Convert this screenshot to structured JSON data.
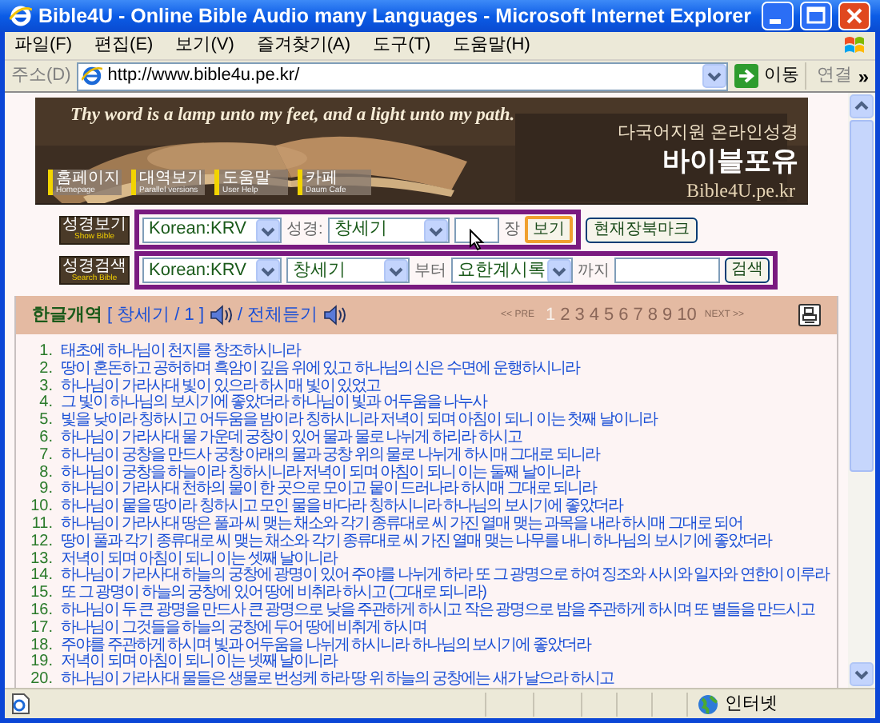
{
  "window": {
    "title": "Bible4U - Online Bible Audio many Languages - Microsoft Internet Explorer"
  },
  "menu": [
    "파일(F)",
    "편집(E)",
    "보기(V)",
    "즐겨찾기(A)",
    "도구(T)",
    "도움말(H)"
  ],
  "address_bar": {
    "label": "주소(D)",
    "value": "http://www.bible4u.pe.kr/",
    "go": "이동",
    "links": "연결",
    "more": "»"
  },
  "banner": {
    "motto": "Thy word is a lamp unto my feet, and a light unto my path.",
    "tagline": "다국어지원 온라인성경",
    "site_name": "바이블포유",
    "domain": "Bible4U.pe.kr",
    "nav": [
      {
        "label": "홈페이지",
        "sub": "Homepage"
      },
      {
        "label": "대역보기",
        "sub": "Parallel versions"
      },
      {
        "label": "도움말",
        "sub": "User Help"
      },
      {
        "label": "카페",
        "sub": "Daum Cafe"
      }
    ]
  },
  "show_bible": {
    "badge": "성경보기",
    "badge_sub": "Show Bible",
    "version": "Korean:KRV",
    "book_label": "성경:",
    "book": "창세기",
    "chapter_unit": "장",
    "view_button": "보기",
    "bookmark_button": "현재장북마크"
  },
  "search_bible": {
    "badge": "성경검색",
    "badge_sub": "Search Bible",
    "version": "Korean:KRV",
    "from_book": "창세기",
    "from_label": "부터",
    "to_book": "요한계시록",
    "to_label": "까지",
    "search_button": "검색"
  },
  "chapter_bar": {
    "version": "한글개역",
    "reference": "[ 창세기 / 1 ]",
    "listen_all": "/ 전체듣기",
    "pager": {
      "prev": "<< PRE",
      "next": "NEXT >>",
      "pages": [
        {
          "label": "1",
          "selected": true
        },
        {
          "label": "2",
          "selected": false
        },
        {
          "label": "3",
          "selected": false
        },
        {
          "label": "4",
          "selected": false
        },
        {
          "label": "5",
          "selected": false
        },
        {
          "label": "6",
          "selected": false
        },
        {
          "label": "7",
          "selected": false
        },
        {
          "label": "8",
          "selected": false
        },
        {
          "label": "9",
          "selected": false
        },
        {
          "label": "10",
          "selected": false
        }
      ]
    }
  },
  "verses": [
    {
      "number": "1.",
      "text": "태초에 하나님이 천지를 창조하시니라"
    },
    {
      "number": "2.",
      "text": "땅이 혼돈하고 공허하며 흑암이 깊음 위에 있고 하나님의 신은 수면에 운행하시니라"
    },
    {
      "number": "3.",
      "text": "하나님이 가라사대 빛이 있으라 하시매 빛이 있었고"
    },
    {
      "number": "4.",
      "text": "그 빛이 하나님의 보시기에 좋았더라 하나님이 빛과 어두움을 나누사"
    },
    {
      "number": "5.",
      "text": "빛을 낮이라 칭하시고 어두움을 밤이라 칭하시니라 저녁이 되며 아침이 되니 이는 첫째 날이니라"
    },
    {
      "number": "6.",
      "text": "하나님이 가라사대 물 가운데 궁창이 있어 물과 물로 나뉘게 하리라 하시고"
    },
    {
      "number": "7.",
      "text": "하나님이 궁창을 만드사 궁창 아래의 물과 궁창 위의 물로 나뉘게 하시매 그대로 되니라"
    },
    {
      "number": "8.",
      "text": "하나님이 궁창을 하늘이라 칭하시니라 저녁이 되며 아침이 되니 이는 둘째 날이니라"
    },
    {
      "number": "9.",
      "text": "하나님이 가라사대 천하의 물이 한 곳으로 모이고 뭍이 드러나라 하시매 그대로 되니라"
    },
    {
      "number": "10.",
      "text": "하나님이 뭍을 땅이라 칭하시고 모인 물을 바다라 칭하시니라 하나님의 보시기에 좋았더라"
    },
    {
      "number": "11.",
      "text": "하나님이 가라사대 땅은 풀과 씨 맺는 채소와 각기 종류대로 씨 가진 열매 맺는 과목을 내라 하시매 그대로 되어"
    },
    {
      "number": "12.",
      "text": "땅이 풀과 각기 종류대로 씨 맺는 채소와 각기 종류대로 씨 가진 열매 맺는 나무를 내니 하나님의 보시기에 좋았더라"
    },
    {
      "number": "13.",
      "text": "저녁이 되며 아침이 되니 이는 셋째 날이니라"
    },
    {
      "number": "14.",
      "text": "하나님이 가라사대 하늘의 궁창에 광명이 있어 주야를 나뉘게 하라 또 그 광명으로 하여 징조와 사시와 일자와 연한이 이루라"
    },
    {
      "number": "15.",
      "text": "또 그 광명이 하늘의 궁창에 있어 땅에 비취라 하시고 (그대로 되니라)"
    },
    {
      "number": "16.",
      "text": "하나님이 두 큰 광명을 만드사 큰 광명으로 낮을 주관하게 하시고 작은 광명으로 밤을 주관하게 하시며 또 별들을 만드시고"
    },
    {
      "number": "17.",
      "text": "하나님이 그것들을 하늘의 궁창에 두어 땅에 비취게 하시며"
    },
    {
      "number": "18.",
      "text": "주야를 주관하게 하시며 빛과 어두움을 나뉘게 하시니라 하나님의 보시기에 좋았더라"
    },
    {
      "number": "19.",
      "text": "저녁이 되며 아침이 되니 이는 넷째 날이니라"
    },
    {
      "number": "20.",
      "text": "하나님이 가라사대 물들은 생물로 번성케 하라 땅 위 하늘의 궁창에는 새가 날으라 하시고"
    }
  ],
  "status_bar": {
    "zone": "인터넷"
  }
}
